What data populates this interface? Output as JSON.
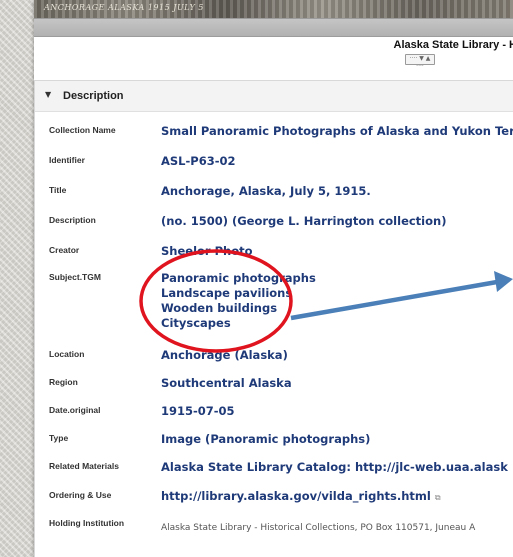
{
  "photo_caption": "ANCHORAGE ALASKA 1915 JULY 5",
  "site_title": "Alaska State Library - H",
  "pager": "···· ▼ ▲ ····",
  "description": {
    "header": "Description",
    "rows": [
      {
        "label": "Collection Name",
        "value": "Small Panoramic Photographs of Alaska and Yukon Terr"
      },
      {
        "label": "Identifier",
        "value": "ASL-P63-02"
      },
      {
        "label": "Title",
        "value": "Anchorage, Alaska, July 5, 1915."
      },
      {
        "label": "Description",
        "value": "(no. 1500) (George L. Harrington collection)"
      },
      {
        "label": "Creator",
        "value": "Sheelor Photo"
      },
      {
        "label": "Subject.TGM",
        "values": [
          "Panoramic photographs",
          "Landscape pavilions",
          "Wooden buildings",
          "Cityscapes"
        ]
      },
      {
        "label": "Location",
        "value": "Anchorage (Alaska)"
      },
      {
        "label": "Region",
        "value": "Southcentral Alaska"
      },
      {
        "label": "Date.original",
        "value": "1915-07-05"
      },
      {
        "label": "Type",
        "value": "Image (Panoramic photographs)"
      },
      {
        "label": "Related Materials",
        "value": "Alaska State Library Catalog: http://jlc-web.uaa.alask"
      },
      {
        "label": "Ordering & Use",
        "value": "http://library.alaska.gov/vilda_rights.html"
      },
      {
        "label": "Holding Institution",
        "value": "Alaska State Library - Historical Collections, PO Box 110571, Juneau A"
      }
    ]
  },
  "annotation": {
    "circle_color": "#e0141e",
    "arrow_color": "#4a7fb8"
  }
}
